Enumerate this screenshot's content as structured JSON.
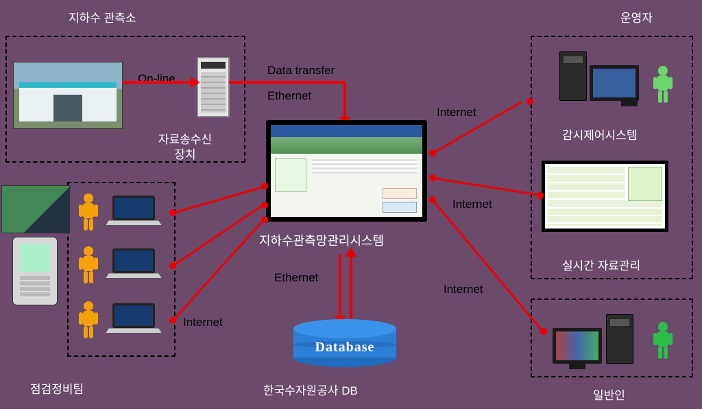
{
  "titles": {
    "station": "지하수 관측소",
    "operator": "운영자",
    "team": "점검정비팀",
    "public": "일반인"
  },
  "connections": {
    "online": "On-line",
    "data_transfer": "Data transfer",
    "ethernet1": "Ethernet",
    "ethernet2": "Ethernet",
    "internet_op": "Internet",
    "internet_data": "Internet",
    "internet_pub": "Internet",
    "internet_team": "Internet"
  },
  "center": {
    "label": "지하수관측망관리시스템"
  },
  "station": {
    "device_label": "자료송수신\n장치"
  },
  "op_panel": {
    "label": "감시제어시스템"
  },
  "data_panel": {
    "label": "실시간 자료관리"
  },
  "db": {
    "label": "Database",
    "owner": "한국수자원공사  DB"
  }
}
